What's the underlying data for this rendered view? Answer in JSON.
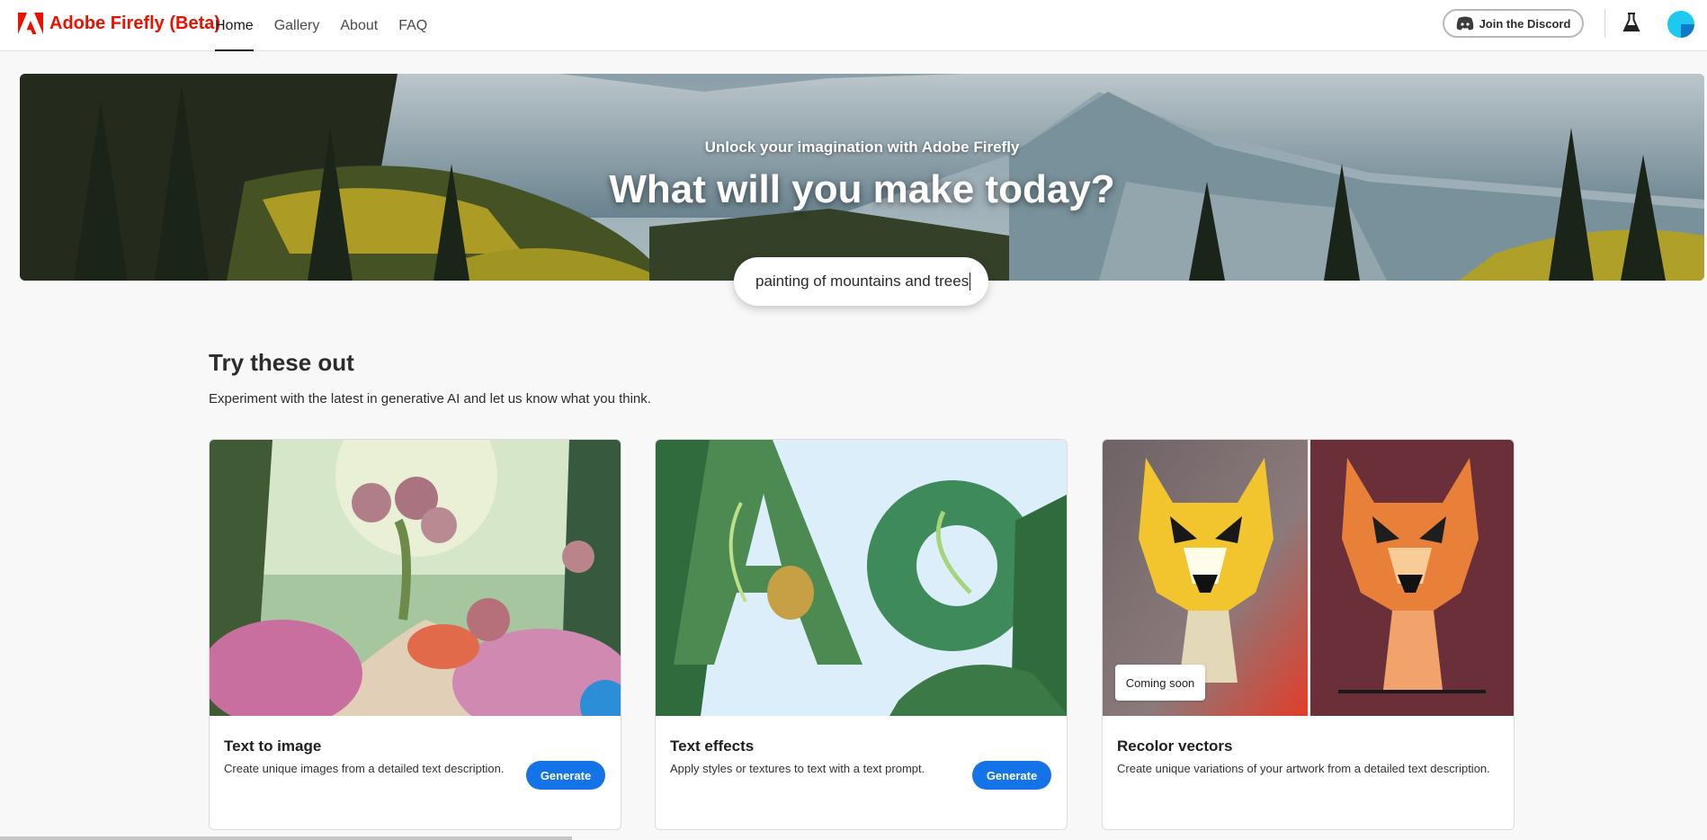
{
  "brand": {
    "name": "Adobe Firefly (Beta)",
    "color": "#eb1000"
  },
  "nav": {
    "tabs": [
      {
        "label": "Home",
        "active": true
      },
      {
        "label": "Gallery",
        "active": false
      },
      {
        "label": "About",
        "active": false
      },
      {
        "label": "FAQ",
        "active": false
      }
    ]
  },
  "header_actions": {
    "discord_label": "Join the Discord",
    "discord_icon": "discord-icon",
    "labs_icon": "beaker-icon",
    "avatar_icon": "user-avatar"
  },
  "hero": {
    "kicker": "Unlock your imagination with Adobe Firefly",
    "headline": "What will you make today?",
    "prompt_value": "painting of mountains and trees"
  },
  "section": {
    "title": "Try these out",
    "subtitle": "Experiment with the latest in generative AI and let us know what you think."
  },
  "cards": [
    {
      "title": "Text to image",
      "description": "Create unique images from a detailed text description.",
      "button": "Generate"
    },
    {
      "title": "Text effects",
      "description": "Apply styles or textures to text with a text prompt.",
      "button": "Generate"
    },
    {
      "title": "Recolor vectors",
      "description": "Create unique variations of your artwork from a detailed text description.",
      "badge": "Coming soon"
    }
  ],
  "colors": {
    "accent": "#1473e6",
    "brand": "#eb1000"
  }
}
